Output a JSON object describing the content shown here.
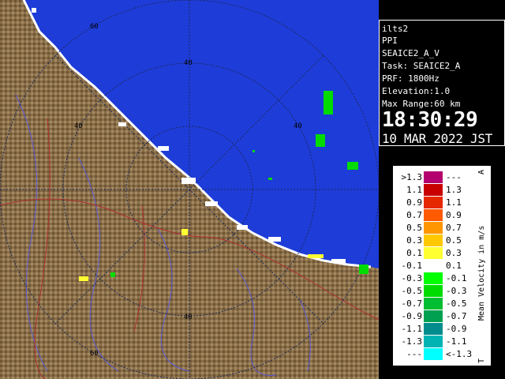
{
  "info": {
    "station": "ilts2",
    "mode": "PPI",
    "product": "SEAICE2_A_V",
    "task": "Task: SEAICE2_A",
    "prf": "PRF: 1800Hz",
    "elevation": "Elevation:1.0",
    "max_range": "Max Range:60 km",
    "time": "18:30:29",
    "date": "10 MAR 2022 JST"
  },
  "range_rings": {
    "labels": [
      "60",
      "40",
      "40",
      "40",
      "40",
      "60"
    ]
  },
  "colors": {
    "sea": "#1e3cd8",
    "land": "#8a6e48",
    "grid": "#1a2a5a",
    "rivers": "#5a5ad8",
    "roads": "#b03030"
  },
  "legend": {
    "title": "Mean Velocity in m/s",
    "corner_top": "A",
    "corner_bottom": "T",
    "rows": [
      {
        "left": ">1.3",
        "right": "---",
        "color": "#b4006e"
      },
      {
        "left": "1.1",
        "right": "1.3",
        "color": "#c80000"
      },
      {
        "left": "0.9",
        "right": "1.1",
        "color": "#e62800"
      },
      {
        "left": "0.7",
        "right": "0.9",
        "color": "#ff5a00"
      },
      {
        "left": "0.5",
        "right": "0.7",
        "color": "#ff9600"
      },
      {
        "left": "0.3",
        "right": "0.5",
        "color": "#ffc800"
      },
      {
        "left": "0.1",
        "right": "0.3",
        "color": "#ffff32"
      },
      {
        "left": "-0.1",
        "right": "0.1",
        "color": "#ffffff"
      },
      {
        "left": "-0.3",
        "right": "-0.1",
        "color": "#00ff00"
      },
      {
        "left": "-0.5",
        "right": "-0.3",
        "color": "#00dc00"
      },
      {
        "left": "-0.7",
        "right": "-0.5",
        "color": "#00be32"
      },
      {
        "left": "-0.9",
        "right": "-0.7",
        "color": "#00a050"
      },
      {
        "left": "-1.1",
        "right": "-0.9",
        "color": "#008c8c"
      },
      {
        "left": "-1.3",
        "right": "-1.1",
        "color": "#00b4b4"
      },
      {
        "left": "---",
        "right": "<-1.3",
        "color": "#00ffff"
      }
    ]
  }
}
